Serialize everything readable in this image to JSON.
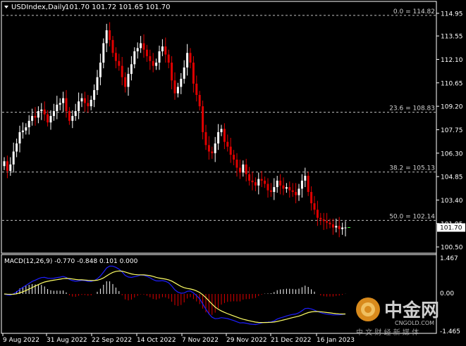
{
  "header": {
    "symbol": "USDIndex,Daily",
    "ohlc": "101.70 101.72 101.65 101.70"
  },
  "price_axis": {
    "ticks": [
      "114.95",
      "113.55",
      "112.10",
      "110.65",
      "109.20",
      "107.75",
      "106.30",
      "104.85",
      "103.40",
      "101.95",
      "100.50"
    ],
    "current_price": "101.70"
  },
  "fibonacci": [
    {
      "label": "0.0 = 114.82",
      "value": 114.82
    },
    {
      "label": "23.6 = 108.83",
      "value": 108.83
    },
    {
      "label": "38.2 = 105.13",
      "value": 105.13
    },
    {
      "label": "50.0 = 102.14",
      "value": 102.14
    }
  ],
  "macd": {
    "label": "MACD(12,26,9) -0.770 -0.848 0.101 0.000",
    "ticks": [
      "1.467",
      "0.00",
      "-1.465"
    ]
  },
  "time_axis": [
    "9 Aug 2022",
    "31 Aug 2022",
    "22 Sep 2022",
    "14 Oct 2022",
    "7 Nov 2022",
    "29 Nov 2022",
    "21 Dec 2022",
    "16 Jan 2023"
  ],
  "watermark": {
    "brand": "中金网",
    "url": "CNGOLD.COM",
    "tagline": "中 文 财 经 新 媒 体"
  },
  "colors": {
    "bull": "#ffffff",
    "bear": "#e00000",
    "grid_dash": "#c0c0c0",
    "macd_main": "#1e1eff",
    "macd_signal": "#ffff66"
  },
  "chart_data": {
    "type": "candlestick",
    "ylim": [
      100.2,
      115.6
    ],
    "closes": [
      105.8,
      105.2,
      105.6,
      106.4,
      106.9,
      107.6,
      107.7,
      107.9,
      108.3,
      108.6,
      108.5,
      108.9,
      109.0,
      108.7,
      108.2,
      108.6,
      108.9,
      109.3,
      109.4,
      109.7,
      108.9,
      108.3,
      108.6,
      108.9,
      109.5,
      109.7,
      109.4,
      109.2,
      109.6,
      110.2,
      111.0,
      111.9,
      113.1,
      113.9,
      113.3,
      112.5,
      112.0,
      111.7,
      111.0,
      110.4,
      111.2,
      111.8,
      112.6,
      112.8,
      113.1,
      112.7,
      112.3,
      112.0,
      111.7,
      111.9,
      112.6,
      112.9,
      112.4,
      111.9,
      110.8,
      110.0,
      110.4,
      110.9,
      111.6,
      112.5,
      111.9,
      110.6,
      109.9,
      109.2,
      107.6,
      106.8,
      106.4,
      106.3,
      106.9,
      107.6,
      107.8,
      107.0,
      106.7,
      106.2,
      105.9,
      105.4,
      105.1,
      105.6,
      105.0,
      104.6,
      104.5,
      104.3,
      104.7,
      104.6,
      104.4,
      104.0,
      103.9,
      104.2,
      104.6,
      104.3,
      104.1,
      104.2,
      104.0,
      103.9,
      103.7,
      104.1,
      104.6,
      104.9,
      103.9,
      103.2,
      102.8,
      102.3,
      102.2,
      102.1,
      102.0,
      101.9,
      101.7,
      101.8,
      101.6,
      101.7,
      101.7
    ]
  }
}
